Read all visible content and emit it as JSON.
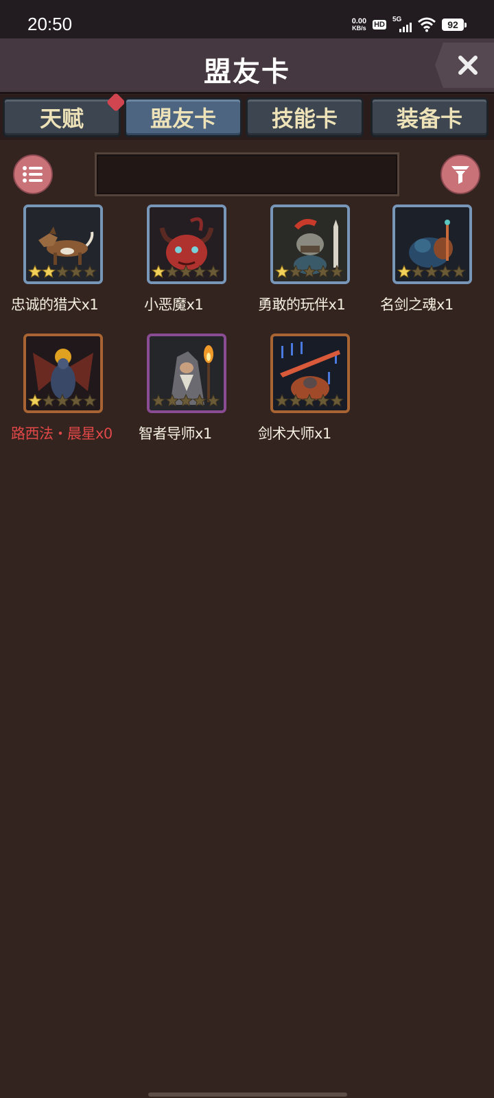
{
  "status_bar": {
    "time": "20:50",
    "net_speed_value": "0.00",
    "net_speed_unit": "KB/s",
    "hd_label": "HD",
    "network_label": "5G",
    "battery": "92"
  },
  "header": {
    "title": "盟友卡"
  },
  "tabs": [
    {
      "label": "天赋",
      "has_badge": true
    },
    {
      "label": "盟友卡",
      "active": true
    },
    {
      "label": "技能卡"
    },
    {
      "label": "装备卡"
    }
  ],
  "search": {
    "value": "",
    "placeholder": ""
  },
  "icons": {
    "list_button": "list-icon",
    "filter_button": "filter-icon",
    "close_button": "close-icon"
  },
  "colors": {
    "background": "#34241f",
    "header": "#463840",
    "round_button": "#c97278",
    "unowned_label": "#e04848",
    "frame_blue": "#7896b8",
    "frame_bronze": "#a86432",
    "frame_purple": "#8a4c92"
  },
  "cards": [
    {
      "label": "忠诚的猎犬x1",
      "stars": 2,
      "max_stars": 5,
      "frame": "blue",
      "art": "hound"
    },
    {
      "label": "小恶魔x1",
      "stars": 1,
      "max_stars": 5,
      "frame": "blue",
      "art": "imp"
    },
    {
      "label": "勇敢的玩伴x1",
      "stars": 1,
      "max_stars": 5,
      "frame": "blue",
      "art": "companion"
    },
    {
      "label": "名剑之魂x1",
      "stars": 1,
      "max_stars": 5,
      "frame": "blue",
      "art": "sword-soul"
    },
    {
      "label": "路西法・晨星x0",
      "stars": 1,
      "max_stars": 5,
      "frame": "bronze",
      "art": "lucifer",
      "owned": false
    },
    {
      "label": "智者导师x1",
      "stars": 0,
      "max_stars": 5,
      "frame": "purple",
      "art": "sage"
    },
    {
      "label": "剑术大师x1",
      "stars": 0,
      "max_stars": 5,
      "frame": "bronze",
      "art": "swordmaster"
    }
  ]
}
